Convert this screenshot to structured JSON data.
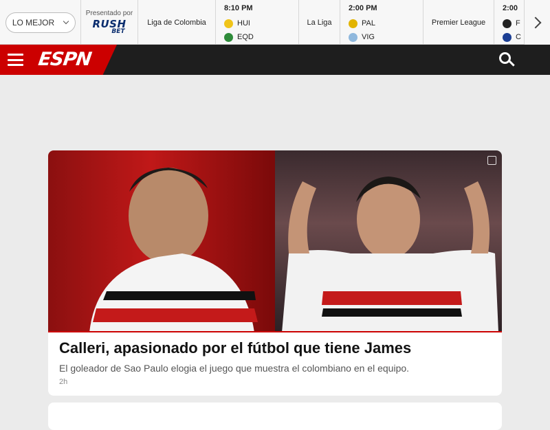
{
  "scoreboard": {
    "filter_label": "LO MEJOR",
    "sponsor_label": "Presentado por",
    "sponsor_logo_top": "RUSH",
    "sponsor_logo_bottom": "BET",
    "items": [
      {
        "league": "Liga de Colombia"
      },
      {
        "time": "8:10 PM",
        "teams": [
          {
            "abbr": "HUI",
            "crest_color": "#f0c419"
          },
          {
            "abbr": "EQD",
            "crest_color": "#2e8b3a"
          }
        ]
      },
      {
        "league": "La Liga"
      },
      {
        "time": "2:00 PM",
        "teams": [
          {
            "abbr": "PAL",
            "crest_color": "#e2b400"
          },
          {
            "abbr": "VIG",
            "crest_color": "#8fb8dd"
          }
        ]
      },
      {
        "league": "Premier League"
      },
      {
        "time": "2:00",
        "teams": [
          {
            "abbr": "F",
            "crest_color": "#222222"
          },
          {
            "abbr": "C",
            "crest_color": "#1c3f94"
          }
        ]
      }
    ]
  },
  "header": {
    "logo_text": "ESPN",
    "brand_color": "#cc0000"
  },
  "story": {
    "headline": "Calleri, apasionado por el fútbol que tiene James",
    "summary": "El goleador de Sao Paulo elogia el juego que muestra el colombiano en el equipo.",
    "age": "2h"
  }
}
